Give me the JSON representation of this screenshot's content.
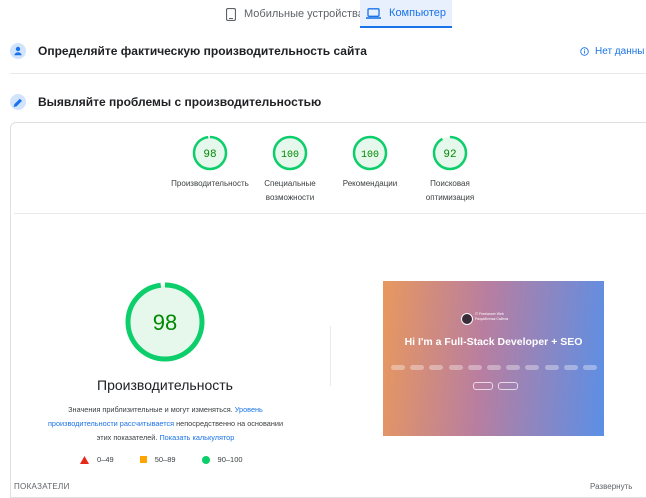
{
  "tabs": {
    "mobile": "Мобильные устройства",
    "desktop": "Компьютер"
  },
  "section1": {
    "title": "Определяйте фактическую производительность сайта",
    "nodata": "Нет данны"
  },
  "section2": {
    "title": "Выявляйте проблемы с производительностью"
  },
  "gauges": [
    {
      "score": "98",
      "fraction": 0.98,
      "label1": "Производительность",
      "label2": ""
    },
    {
      "score": "100",
      "fraction": 1.0,
      "label1": "Специальные",
      "label2": "возможности"
    },
    {
      "score": "100",
      "fraction": 1.0,
      "label1": "Рекомендации",
      "label2": ""
    },
    {
      "score": "92",
      "fraction": 0.92,
      "label1": "Поисковая",
      "label2": "оптимизация"
    }
  ],
  "main": {
    "score": "98",
    "fraction": 0.98,
    "title": "Производительность",
    "desc_a": "Значения приблизительные и могут изменяться. ",
    "link1": "Уровень",
    "link2": "производительности рассчитывается",
    "desc_b": " непосредственно на основании",
    "desc_c": "этих показателей. ",
    "link3": "Показать калькулятор"
  },
  "legend": {
    "poor": "0–49",
    "avg": "50–89",
    "good": "90–100"
  },
  "screenshot": {
    "headline": "Hi I'm a Full-Stack Developer + SEO",
    "name_line1": "IT Freelancer Web",
    "name_line2": "Разработчик Сайтов"
  },
  "footer": {
    "left": "ПОКАЗАТЕЛИ",
    "right": "Развернуть"
  },
  "colors": {
    "good": "#0cce6b",
    "good_text": "#008800",
    "good_bg": "#e6f7ec",
    "accent": "#1a73e8",
    "poor": "#e8281b",
    "average": "#ffa400"
  }
}
